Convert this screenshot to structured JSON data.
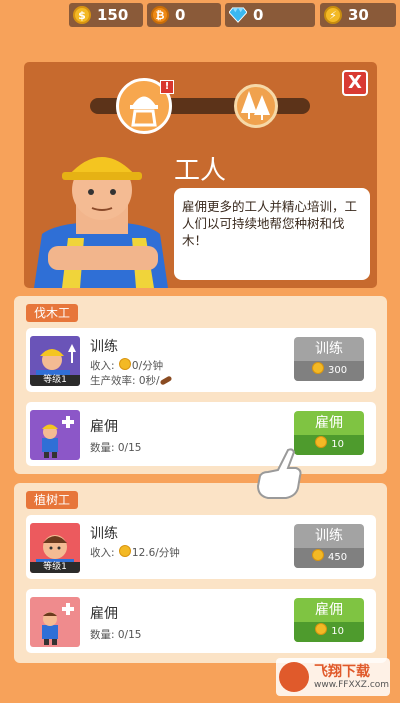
{
  "currencies": {
    "coins": "150",
    "bitcoin": "0",
    "gems": "0",
    "energy": "30"
  },
  "icons": {
    "coin": "coin-icon",
    "bitcoin": "bitcoin-icon",
    "gem": "gem-icon",
    "energy": "energy-icon",
    "close": "close-icon"
  },
  "header": {
    "title": "工人",
    "description": "雇佣更多的工人并精心培训，工人们以可持续地帮您种树和伐木！",
    "close_label": "X",
    "alert_label": "!"
  },
  "sections": [
    {
      "label": "伐木工",
      "train": {
        "title": "训练",
        "level": "等级1",
        "income_prefix": "收入: ",
        "income_value": "0/分钟",
        "efficiency": "生产效率: 0秒/",
        "button_label": "训练",
        "cost": "300"
      },
      "hire": {
        "title": "雇佣",
        "count": "数量: 0/15",
        "button_label": "雇佣",
        "cost": "10"
      }
    },
    {
      "label": "植树工",
      "train": {
        "title": "训练",
        "level": "等级1",
        "income_prefix": "收入: ",
        "income_value": "12.6/分钟",
        "button_label": "训练",
        "cost": "450"
      },
      "hire": {
        "title": "雇佣",
        "count": "数量: 0/15",
        "button_label": "雇佣",
        "cost": "10"
      }
    }
  ],
  "watermark": {
    "name": "飞翔下载",
    "url": "www.FFXXZ.com"
  },
  "colors": {
    "background": "#f7a25a",
    "panel": "#c76a2e",
    "train_button": "#a3a3a3",
    "hire_button": "#7fc442"
  }
}
